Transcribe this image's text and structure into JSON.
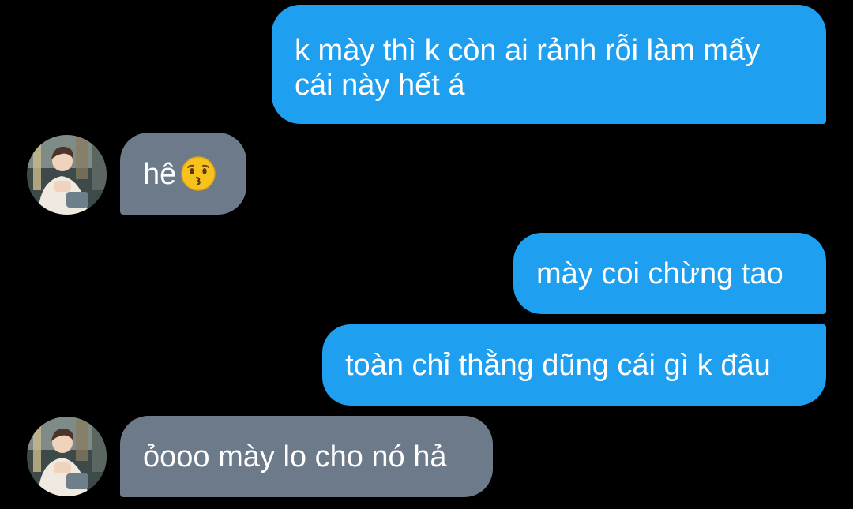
{
  "messages": [
    {
      "sender": "me",
      "text": "k mày thì k còn ai rảnh rỗi làm mấy cái này hết á"
    },
    {
      "sender": "friend",
      "text": "hê",
      "emoji": "kissing-face-icon"
    },
    {
      "sender": "me",
      "text": "mày coi chừng tao"
    },
    {
      "sender": "me",
      "text": "toàn chỉ thằng dũng cái gì k đâu"
    },
    {
      "sender": "friend",
      "text": "ỏooo mày lo cho nó hả"
    }
  ],
  "colors": {
    "background": "#000000",
    "outgoing_bubble": "#1e9ff0",
    "incoming_bubble": "#6c7a8a",
    "text": "#ffffff"
  }
}
